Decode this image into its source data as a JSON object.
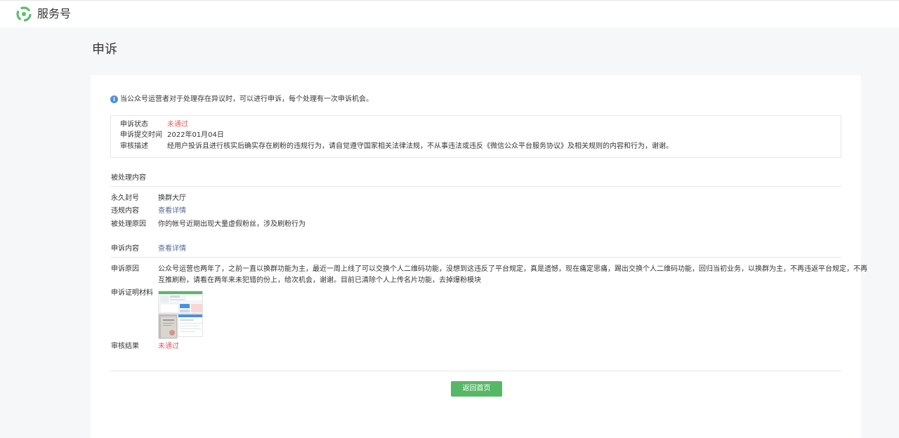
{
  "header": {
    "brand": "服务号"
  },
  "page": {
    "title": "申诉"
  },
  "notice": {
    "text": "当公众号运营者对于处理存在异议时，可以进行申诉，每个处理有一次申诉机会。"
  },
  "status_box": {
    "status_label": "申诉状态",
    "status_value": "未通过",
    "time_label": "申诉提交时间",
    "time_value": "2022年01月04日",
    "desc_label": "审核描述",
    "desc_value": "经用户投诉且进行核实后确实存在刷粉的违规行为，请自觉遵守国家相关法律法规，不从事违法或违反《微信公众平台服务协议》及相关规则的内容和行为，谢谢。"
  },
  "processed": {
    "heading": "被处理内容",
    "ban_label": "永久封号",
    "ban_value": "换群大厅",
    "content_label": "违规内容",
    "content_link": "查看详情",
    "reason_label": "被处理原因",
    "reason_value": "你的帐号近期出现大量虚假粉丝，涉及刷粉行为"
  },
  "appeal": {
    "content_label": "申诉内容",
    "content_link": "查看详情",
    "reason_label": "申诉原因",
    "reason_line1": "公众号运营也两年了，之前一直以换群功能为主，最近一周上线了可以交换个人二维码功能，没想到这违反了平台规定，真是遗憾，现在痛定思痛，踢出交换个人二维码功能，回归当初业务，以换群为主，不再违返平台规定，不再",
    "reason_line2": "互推刷粉，请看在两年来未犯错的份上，给次机会，谢谢。目前已清除个人上传名片功能，去掉爆粉模块",
    "evidence_label": "申诉证明材料",
    "result_label": "审核结果",
    "result_value": "未通过"
  },
  "actions": {
    "back_label": "返回首页"
  },
  "colors": {
    "accent_green": "#56b866",
    "error_red": "#e15f63",
    "link_blue": "#576b95",
    "info_blue": "#4a90e2"
  },
  "icons": {
    "logo": "wechat-service-logo-icon",
    "notice": "info-circle-icon"
  }
}
